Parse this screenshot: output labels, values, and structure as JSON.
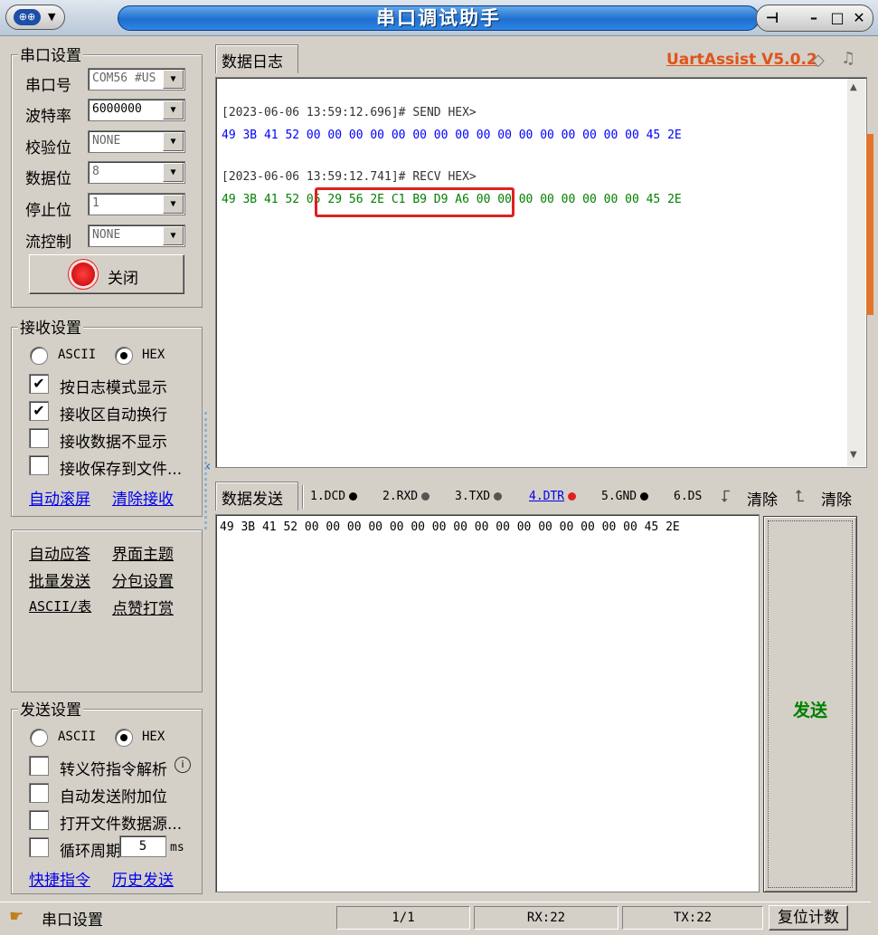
{
  "window": {
    "title": "串口调试助手",
    "min_glyph": "–",
    "max_glyph": "□",
    "close_glyph": "✕",
    "pin_glyph": "⊣"
  },
  "serial_settings": {
    "title": "串口设置",
    "port_label": "串口号",
    "port_value": "COM56 #US",
    "baud_label": "波特率",
    "baud_value": "6000000",
    "parity_label": "校验位",
    "parity_value": "NONE",
    "databits_label": "数据位",
    "databits_value": "8",
    "stopbits_label": "停止位",
    "stopbits_value": "1",
    "flow_label": "流控制",
    "flow_value": "NONE",
    "open_button": "关闭"
  },
  "receive_settings": {
    "title": "接收设置",
    "ascii_label": "ASCII",
    "hex_label": "HEX",
    "mode": "HEX",
    "options": [
      {
        "label": "按日志模式显示",
        "checked": true
      },
      {
        "label": "接收区自动换行",
        "checked": true
      },
      {
        "label": "接收数据不显示",
        "checked": false
      },
      {
        "label": "接收保存到文件...",
        "checked": false
      }
    ],
    "link_autoscroll": "自动滚屏",
    "link_clear": "清除接收"
  },
  "tools": {
    "auto_reply": "自动应答",
    "theme": "界面主题",
    "batch_send": "批量发送",
    "packet_settings": "分包设置",
    "ascii_table": "ASCII/表",
    "donate": "点赞打赏"
  },
  "send_settings": {
    "title": "发送设置",
    "ascii_label": "ASCII",
    "hex_label": "HEX",
    "mode": "HEX",
    "options": [
      {
        "label": "转义符指令解析",
        "checked": false
      },
      {
        "label": "自动发送附加位",
        "checked": false
      },
      {
        "label": "打开文件数据源...",
        "checked": false
      },
      {
        "label": "循环周期",
        "checked": false
      }
    ],
    "period_value": "5",
    "period_unit": "ms",
    "link_shortcuts": "快捷指令",
    "link_history": "历史发送"
  },
  "log": {
    "tab": "数据日志",
    "brand": "UartAssist V5.0.2",
    "entries": [
      {
        "header": "[2023-06-06 13:59:12.696]# SEND HEX>",
        "data": "49 3B 41 52 00 00 00 00 00 00 00 00 00 00 00 00 00 00 00 00 45 2E",
        "color": "#0000ff"
      },
      {
        "header": "[2023-06-06 13:59:12.741]# RECV HEX>",
        "data": "49 3B 41 52 05 29 56 2E C1 B9 D9 A6 00 00 00 00 00 00 00 00 45 2E",
        "color": "#008000"
      }
    ],
    "highlight_color": "#e02020"
  },
  "send": {
    "tab": "数据发送",
    "pins": [
      {
        "label": "1.DCD",
        "color": "#000000"
      },
      {
        "label": "2.RXD",
        "color": "#555555"
      },
      {
        "label": "3.TXD",
        "color": "#555555"
      },
      {
        "label": "4.DTR",
        "color": "#e02020"
      },
      {
        "label": "5.GND",
        "color": "#000000"
      },
      {
        "label": "6.DS",
        "color": "#000000"
      }
    ],
    "clear1": "清除",
    "clear2": "清除",
    "content": "49 3B 41 52 00 00 00 00 00 00 00 00 00 00 00 00 00 00 00 00 45 2E",
    "send_button": "发送"
  },
  "status": {
    "label": "串口设置",
    "page": "1/1",
    "rx": "RX:22",
    "tx": "TX:22",
    "reset": "复位计数"
  }
}
